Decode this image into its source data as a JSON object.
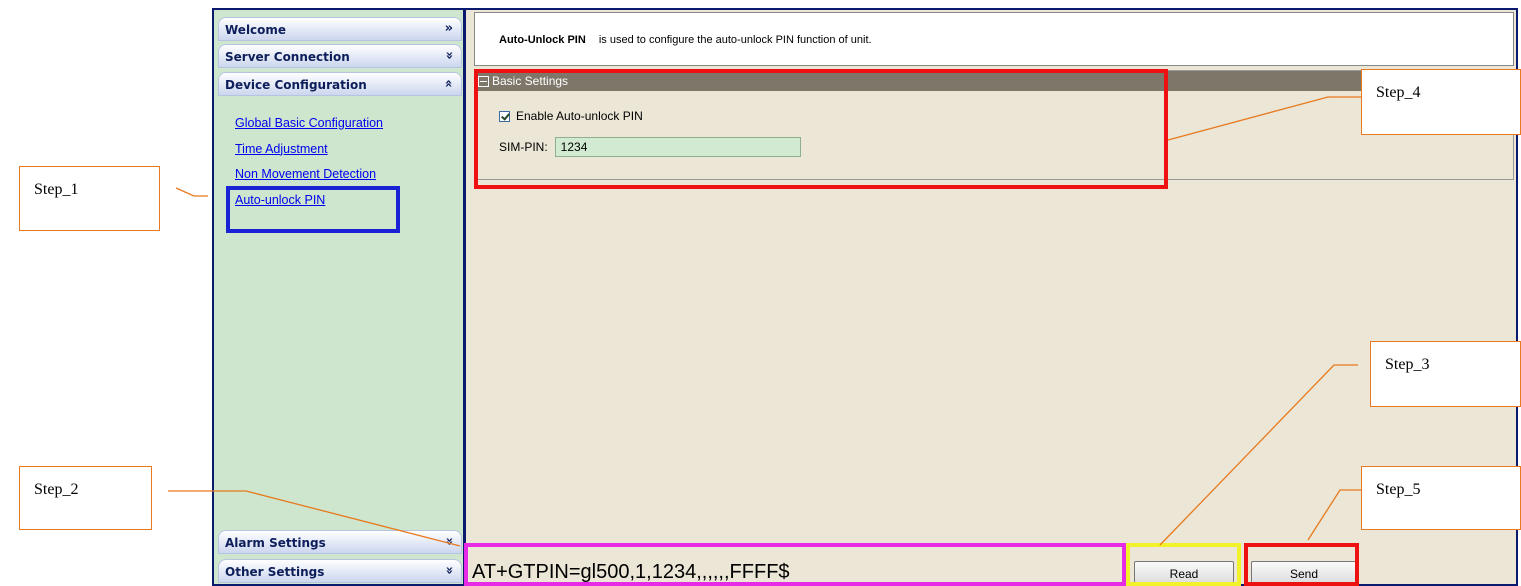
{
  "sidebar": {
    "sections": {
      "welcome": "Welcome",
      "server_connection": "Server Connection",
      "device_configuration": "Device Configuration",
      "alarm_settings": "Alarm Settings",
      "other_settings": "Other Settings"
    },
    "links": [
      "Global Basic Configuration",
      "Time Adjustment",
      "Non Movement Detection",
      "Auto-unlock PIN"
    ]
  },
  "main": {
    "description_title": "Auto-Unlock PIN",
    "description_text": "is used to configure the auto-unlock PIN function of unit.",
    "section_title": "Basic Settings",
    "enable_label": "Enable Auto-unlock PIN",
    "enable_checked": true,
    "sim_pin_label": "SIM-PIN:",
    "sim_pin_value": "1234"
  },
  "bottom": {
    "command": "AT+GTPIN=gl500,1,1234,,,,,,FFFF$",
    "read_label": "Read",
    "send_label": "Send"
  },
  "annotations": {
    "step1": "Step_1",
    "step2": "Step_2",
    "step3": "Step_3",
    "step4": "Step_4",
    "step5": "Step_5"
  },
  "colors": {
    "frame": "#0a1a6e",
    "sidebar_bg": "#cde6cd",
    "panel_bg": "#ebe6d6",
    "step_border": "#e8791e",
    "highlight_blue": "#1a22d6",
    "highlight_red": "#ee1111",
    "highlight_magenta": "#e62ae6",
    "highlight_yellow": "#f2f22a"
  }
}
